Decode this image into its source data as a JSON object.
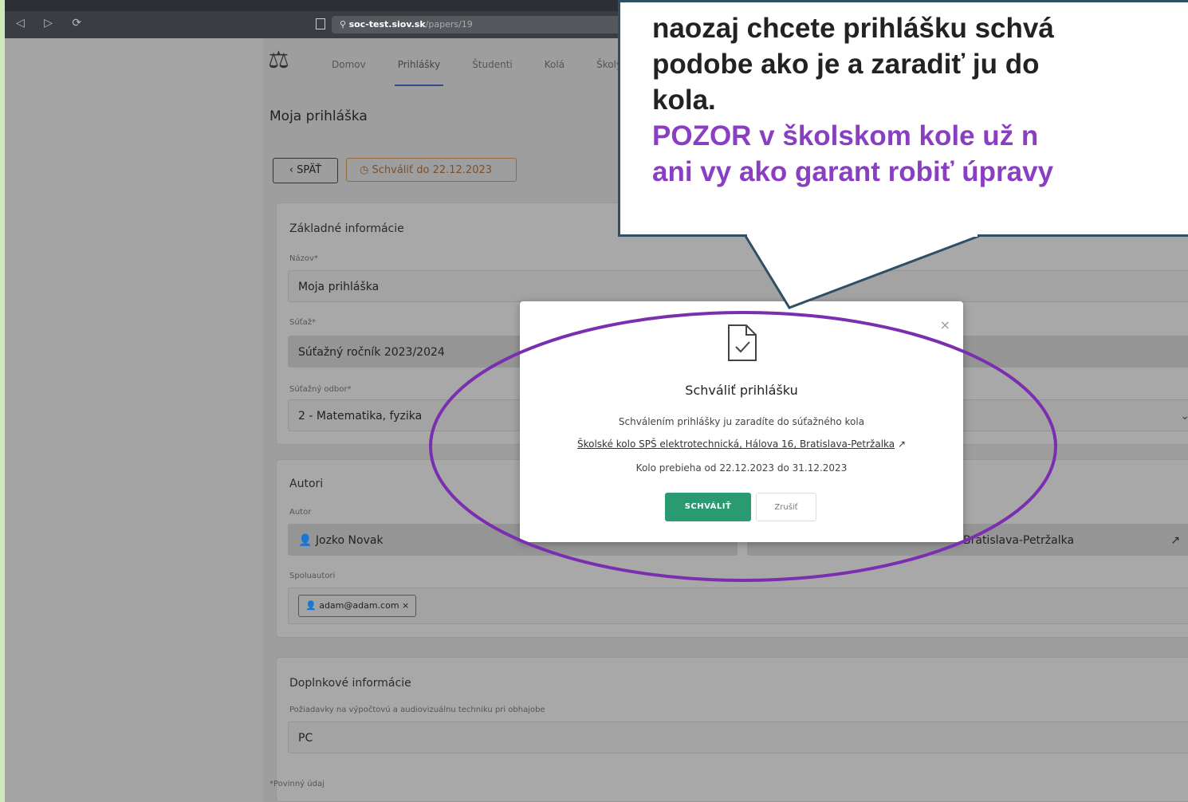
{
  "browser": {
    "nav_icons": "◁ ▷ ⟳",
    "url_host": "soc-test.siov.sk",
    "url_path": "/papers/19"
  },
  "nav": {
    "logo": "⚖",
    "items": [
      "Domov",
      "Prihlášky",
      "Študenti",
      "Kolá",
      "Školy"
    ]
  },
  "page": {
    "title": "Moja prihláška",
    "back_label": "SPÄŤ",
    "due_label": "Schváliť do 22.12.2023"
  },
  "basic": {
    "title": "Základné informácie",
    "name_label": "Názov*",
    "name_value": "Moja prihláška",
    "comp_label": "Súťaž*",
    "comp_value": "Súťažný ročník 2023/2024",
    "field_label": "Súťažný odbor*",
    "field_value": "2 - Matematika, fyzika"
  },
  "authors": {
    "title": "Autori",
    "author_label": "Autor",
    "author_value": "Jozko Novak",
    "school_value": "Bratislava-Petržalka",
    "coauthors_label": "Spoluautori",
    "coauthor_chip": "adam@adam.com"
  },
  "extra": {
    "title": "Doplnkové informácie",
    "req_label": "Požiadavky na výpočtovú a audiovizuálnu techniku pri obhajobe",
    "req_value": "PC"
  },
  "footer_note": "*Povinný údaj",
  "callout": {
    "line1": "naozaj chcete prihlášku schvá",
    "line2": "podobe ako je a zaradiť ju do",
    "line3": "kola.",
    "line4": "POZOR  v školskom kole už n",
    "line5": "ani vy ako garant robiť úpravy"
  },
  "modal": {
    "title": "Schváliť prihlášku",
    "text": "Schválením prihlášky ju zaradíte do súťažného kola",
    "link": "Školské kolo SPŠ elektrotechnická, Hálova 16, Bratislava-Petržalka",
    "dates": "Kolo prebieha od 22.12.2023 do 31.12.2023",
    "approve_label": "SCHVÁLIŤ",
    "cancel_label": "Zrušiť"
  },
  "colors": {
    "accent_green": "#2a9a72",
    "annotation_purple": "#7a2fb0",
    "callout_border": "#2f4f64"
  }
}
